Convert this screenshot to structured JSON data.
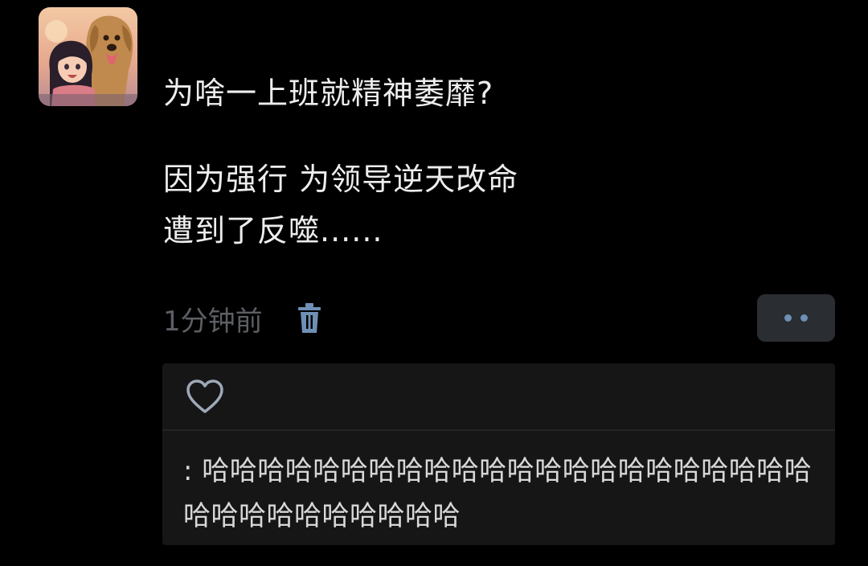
{
  "post": {
    "lines": [
      "为啥一上班就精神萎靡?",
      "因为强行 为领导逆天改命",
      "遭到了反噬......"
    ],
    "time": "1分钟前"
  },
  "comment": {
    "prefix": ":",
    "text": "哈哈哈哈哈哈哈哈哈哈哈哈哈哈哈哈哈哈哈哈哈哈哈哈哈哈哈哈哈哈哈哈"
  },
  "icons": {
    "delete": "trash-icon",
    "more": "more-dots-icon",
    "like": "heart-icon"
  },
  "colors": {
    "background": "#000000",
    "panel": "#161616",
    "accent": "#6f8fb5",
    "time": "#5c5f64"
  }
}
